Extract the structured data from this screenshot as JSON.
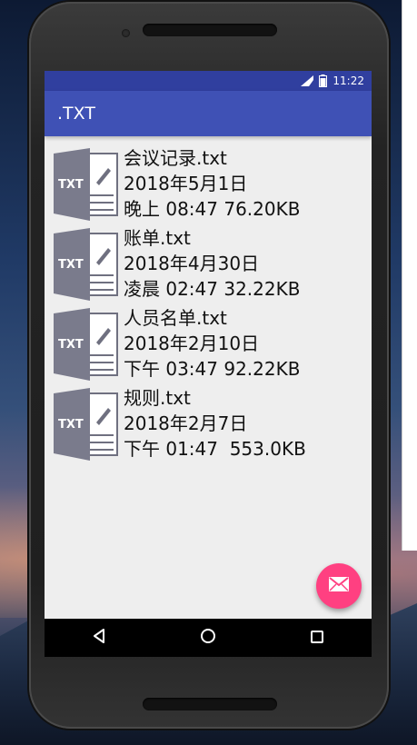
{
  "status_bar": {
    "time": "11:22",
    "signal_icon": "signal-icon",
    "battery_icon": "battery-icon"
  },
  "app_bar": {
    "title": ".TXT"
  },
  "files": [
    {
      "name": "会议记录.txt",
      "date": "2018年5月1日",
      "time_size": "晚上 08:47 76.20KB",
      "icon_label": "TXT"
    },
    {
      "name": "账单.txt",
      "date": "2018年4月30日",
      "time_size": "凌晨 02:47 32.22KB",
      "icon_label": "TXT"
    },
    {
      "name": "人员名单.txt",
      "date": "2018年2月10日",
      "time_size": "下午 03:47 92.22KB",
      "icon_label": "TXT"
    },
    {
      "name": "规则.txt",
      "date": "2018年2月7日",
      "time_size": "下午 01:47  553.0KB",
      "icon_label": "TXT"
    }
  ],
  "fab": {
    "icon": "mail-icon",
    "color": "#ff4081"
  },
  "nav": {
    "back_icon": "back-icon",
    "home_icon": "home-icon",
    "recents_icon": "recents-icon"
  },
  "colors": {
    "status_bar": "#303f9f",
    "app_bar": "#3f51b5",
    "screen_bg": "#eeeeee"
  }
}
